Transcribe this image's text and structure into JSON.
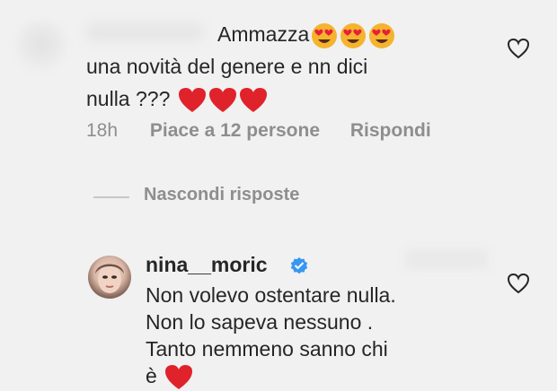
{
  "comment": {
    "text_line1": "Ammazza",
    "text_line2": "una novità del genere e nn dici",
    "text_line3": "nulla ???",
    "time": "18h",
    "likes": "Piace a 12 persone",
    "reply": "Rispondi"
  },
  "replies_toggle": {
    "label": "Nascondi risposte"
  },
  "reply": {
    "username": "nina__moric",
    "line1": "Non volevo ostentare nulla.",
    "line2": "Non lo sapeva nessuno .",
    "line3": "Tanto nemmeno sanno chi",
    "line4": "è"
  },
  "icons": {
    "like": "heart-outline-icon",
    "emoji_eyes": "heart-eyes-emoji",
    "emoji_heart": "red-heart-emoji",
    "verified": "verified-badge-icon"
  },
  "colors": {
    "background": "#f1f1f1",
    "text": "#262626",
    "meta": "#8e8e8e",
    "heart": "#e0222b",
    "verified": "#3897f0"
  }
}
